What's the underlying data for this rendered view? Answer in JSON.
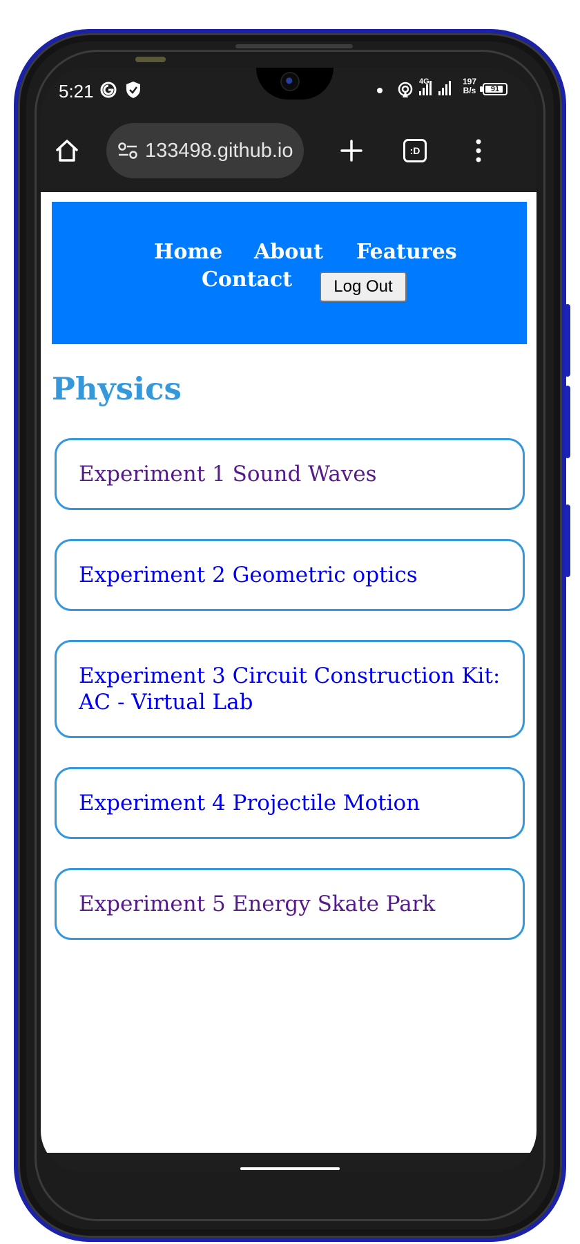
{
  "status_bar": {
    "time": "5:21",
    "network_type": "4G",
    "speed_value": "197",
    "speed_unit": "B/s",
    "battery_level": "91",
    "battery_fraction": 0.91
  },
  "browser": {
    "url": "133498.github.io",
    "tab_count_label": ":D"
  },
  "site": {
    "nav": {
      "home": "Home",
      "about": "About",
      "features": "Features",
      "contact": "Contact"
    },
    "logout_label": "Log Out",
    "page_title": "Physics",
    "experiments": [
      {
        "label": "Experiment 1 Sound Waves",
        "visited": true
      },
      {
        "label": "Experiment 2 Geometric optics",
        "visited": false
      },
      {
        "label": "Experiment 3 Circuit Construction Kit: AC - Virtual Lab",
        "visited": false
      },
      {
        "label": "Experiment 4 Projectile Motion",
        "visited": false
      },
      {
        "label": "Experiment 5 Energy Skate Park",
        "visited": true
      }
    ]
  },
  "colors": {
    "header_bg": "#007bff",
    "title_blue": "#3498db",
    "card_border": "#3498db",
    "link_visited": "#551a8b",
    "link_unvisited": "#0000ee",
    "phone_frame": "#1b22a8"
  }
}
